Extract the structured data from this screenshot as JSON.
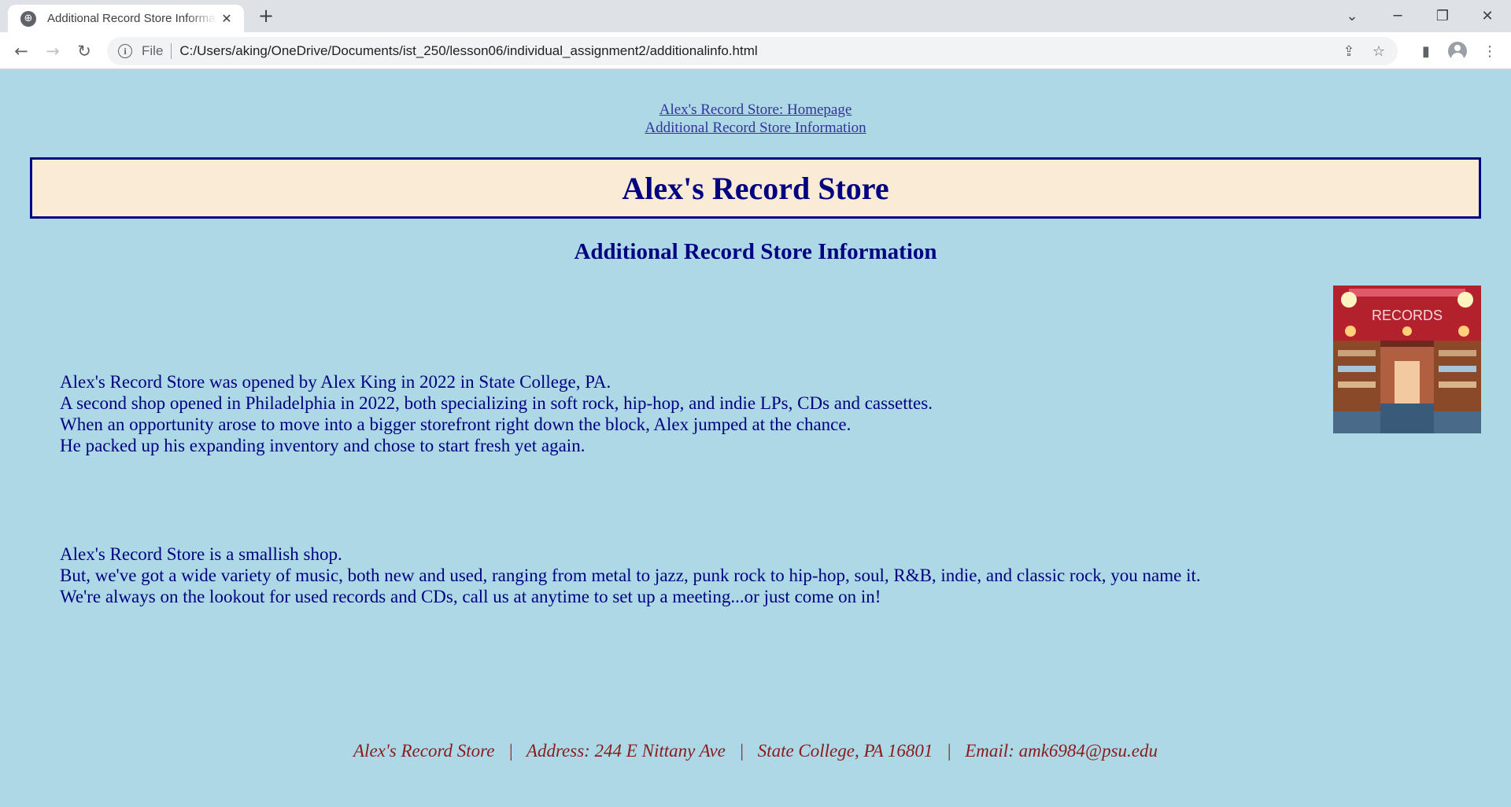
{
  "browser": {
    "tab_title": "Additional Record Store Information",
    "tab_favicon": "globe-icon",
    "new_tab_symbol": "+",
    "close_symbol": "✕",
    "file_label": "File",
    "url": "C:/Users/aking/OneDrive/Documents/ist_250/lesson06/individual_assignment2/additionalinfo.html"
  },
  "nav": {
    "links": [
      "Alex's Record Store: Homepage",
      "Additional Record Store Information"
    ]
  },
  "header": {
    "title": "Alex's Record Store",
    "subtitle": "Additional Record Store Information"
  },
  "photo": {
    "sign_text": "RECORDS"
  },
  "content": {
    "paragraph1": [
      "Alex's Record Store was opened by Alex King in 2022 in State College, PA.",
      "A second shop opened in Philadelphia in 2022, both specializing in soft rock, hip-hop, and indie LPs, CDs and cassettes.",
      "When an opportunity arose to move into a bigger storefront right down the block, Alex jumped at the chance.",
      "He packed up his expanding inventory and chose to start fresh yet again."
    ],
    "paragraph2": [
      "Alex's Record Store is a smallish shop.",
      "But, we've got a wide variety of music, both new and used, ranging from metal to jazz, punk rock to hip-hop, soul, R&B, indie, and classic rock, you name it.",
      "We're always on the lookout for used records and CDs, call us at anytime to set up a meeting...or just come on in!"
    ]
  },
  "footer": {
    "text": "Alex's Record Store   |   Address: 244 E Nittany Ave   |   State College, PA 16801   |   Email: amk6984@psu.edu"
  },
  "colors": {
    "page_background": "#add8e6",
    "banner_background": "#faebd7",
    "heading_text": "#000080",
    "footer_text": "#8b1a1a"
  }
}
